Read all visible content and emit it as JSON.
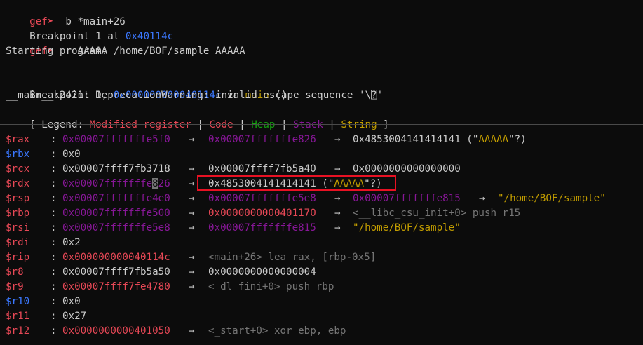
{
  "prompt": "gef➤  ",
  "cmd1": "b *main+26",
  "bp_set": {
    "text": "Breakpoint 1 at ",
    "addr": "0x40114c"
  },
  "cmd2": "r AAAAA",
  "starting": "Starting program: /home/BOF/sample AAAAA",
  "bp_hit": {
    "prefix": "Breakpoint 1, ",
    "addr": "0x000000000040114c",
    "in": " in ",
    "func": "main",
    "args": " ()"
  },
  "warning": "__main__:2421: DeprecationWarning: invalid escape sequence '\\⍰'",
  "legend": {
    "open": "[ Legend: ",
    "modified": "Modified register",
    "sep": " | ",
    "code": "Code",
    "heap": "Heap",
    "stack": "Stack",
    "string": "String",
    "close": " ]"
  },
  "arrow": "→",
  "colon": ":",
  "registers": [
    {
      "name": "$rax",
      "name_color": "red",
      "v1": "0x00007fffffffe5f0",
      "v1_color": "purple",
      "v2": "0x00007fffffffe826",
      "v2_color": "purple",
      "v3": "0x4853004141414141 (\"AAAAA\"?)",
      "v3_color": "white"
    },
    {
      "name": "$rbx",
      "name_color": "blue",
      "v1": "0x0",
      "v1_color": "white"
    },
    {
      "name": "$rcx",
      "name_color": "red",
      "v1": "0x00007ffff7fb3718",
      "v1_color": "white",
      "v2": "0x00007ffff7fb5a40",
      "v2_color": "white",
      "v3": "0x0000000000000000",
      "v3_color": "white"
    },
    {
      "name": "$rdx",
      "name_color": "red",
      "v1a": "0x00007fffffffe",
      "v1b": "8",
      "v1c": "26",
      "v1_color": "purple",
      "v2": "0x4853004141414141 (\"AAAAA\"?)",
      "v2_color": "white"
    },
    {
      "name": "$rsp",
      "name_color": "red",
      "v1": "0x00007fffffffe4e0",
      "v1_color": "purple",
      "v2": "0x00007fffffffe5e8",
      "v2_color": "purple",
      "v3": "0x00007fffffffe815",
      "v3_color": "purple",
      "v4": "\"/home/BOF/sample\"",
      "v4_color": "yellow"
    },
    {
      "name": "$rbp",
      "name_color": "red",
      "v1": "0x00007fffffffe500",
      "v1_color": "purple",
      "v2": "0x0000000000401170",
      "v2_color": "red",
      "v3": "<__libc_csu_init+0> push r15",
      "v3_color": "gray"
    },
    {
      "name": "$rsi",
      "name_color": "red",
      "v1": "0x00007fffffffe5e8",
      "v1_color": "purple",
      "v2": "0x00007fffffffe815",
      "v2_color": "purple",
      "v3": "\"/home/BOF/sample\"",
      "v3_color": "yellow"
    },
    {
      "name": "$rdi",
      "name_color": "red",
      "v1": "0x2",
      "v1_color": "white"
    },
    {
      "name": "$rip",
      "name_color": "red",
      "v1": "0x000000000040114c",
      "v1_color": "red",
      "v2": "<main+26> lea rax, [rbp-0x5]",
      "v2_color": "gray"
    },
    {
      "name": "$r8",
      "name_color": "red",
      "v1": "0x00007ffff7fb5a50",
      "v1_color": "white",
      "v2": "0x0000000000000004",
      "v2_color": "white"
    },
    {
      "name": "$r9",
      "name_color": "red",
      "v1": "0x00007ffff7fe4780",
      "v1_color": "red",
      "v2": "<_dl_fini+0> push rbp",
      "v2_color": "gray"
    },
    {
      "name": "$r10",
      "name_color": "blue",
      "v1": "0x0",
      "v1_color": "white"
    },
    {
      "name": "$r11",
      "name_color": "red",
      "v1": "0x27",
      "v1_color": "white"
    },
    {
      "name": "$r12",
      "name_color": "red",
      "v1": "0x0000000000401050",
      "v1_color": "red",
      "v2": "<_start+0> xor ebp, ebp",
      "v2_color": "gray"
    }
  ]
}
